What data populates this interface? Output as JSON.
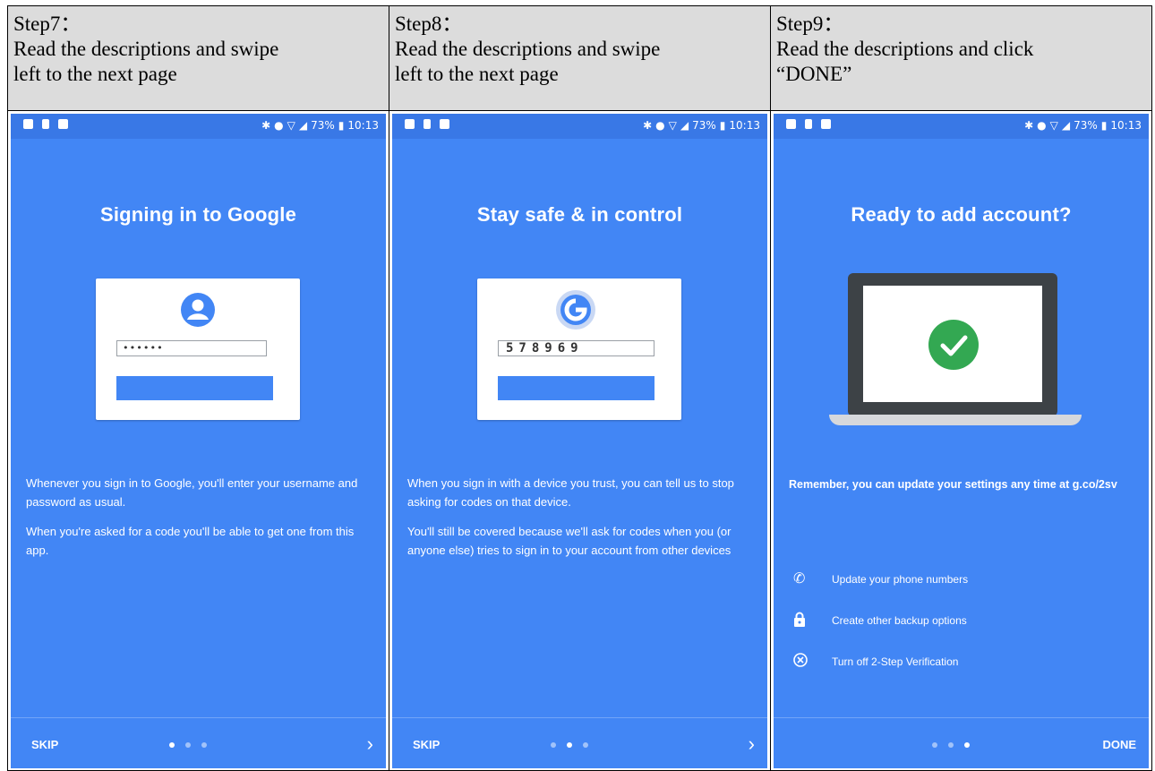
{
  "steps": [
    {
      "step_label": "Step7：",
      "instruction_line1": "Read the descriptions and swipe",
      "instruction_line2": "left to the next page",
      "status_time": "10:13",
      "status_battery": "73%",
      "screen_title": "Signing in to Google",
      "password_mask": "••••••",
      "desc_p1": "Whenever you sign in to Google, you'll enter your username and password as usual.",
      "desc_p2": "When you're asked for a code you'll be able to get one from this app.",
      "footer_left": "SKIP",
      "footer_right": "›",
      "active_dot": 0
    },
    {
      "step_label": "Step8：",
      "instruction_line1": "Read the descriptions and swipe",
      "instruction_line2": "left to the next page",
      "status_time": "10:13",
      "status_battery": "73%",
      "screen_title": "Stay safe & in control",
      "code_value": "578969",
      "desc_p1": "When you sign in with a device you trust, you can tell us to stop asking for codes on that device.",
      "desc_p2": "You'll still be covered because we'll ask for codes when you (or anyone else) tries to sign in to your account from other devices",
      "footer_left": "SKIP",
      "footer_right": "›",
      "active_dot": 1
    },
    {
      "step_label": "Step9：",
      "instruction_line1": "Read the descriptions and click",
      "instruction_line2": "“DONE”",
      "status_time": "10:13",
      "status_battery": "73%",
      "screen_title": "Ready to add account?",
      "desc_p1": "Remember, you can update your settings any time at g.co/2sv",
      "options": [
        {
          "icon": "phone-icon",
          "label": "Update your phone numbers"
        },
        {
          "icon": "lock-icon",
          "label": "Create other backup options"
        },
        {
          "icon": "close-circle-icon",
          "label": "Turn off 2-Step Verification"
        }
      ],
      "footer_right": "DONE",
      "active_dot": 2
    }
  ],
  "colors": {
    "screen_blue": "#4286f5",
    "statusbar_blue": "#3978e6",
    "check_green": "#33a852",
    "header_gray": "#dcdcdc"
  }
}
